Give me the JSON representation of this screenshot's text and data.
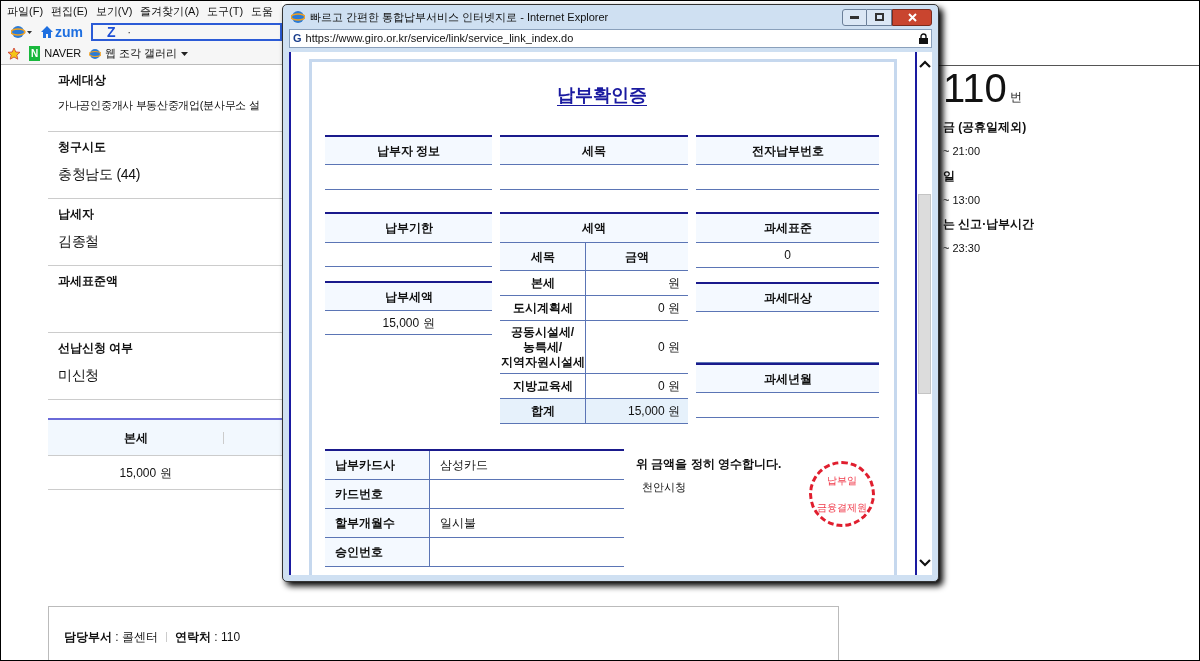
{
  "browser": {
    "menu": [
      "파일(F)",
      "편집(E)",
      "보기(V)",
      "즐겨찾기(A)",
      "도구(T)",
      "도움"
    ],
    "home_label": "zum",
    "search_logo": "Z",
    "address_text": "·",
    "favorites": [
      {
        "label": "NAVER",
        "badge": "N",
        "dropdown": false
      },
      {
        "label": "웹 조각 갤러리",
        "dropdown": true
      }
    ]
  },
  "page": {
    "fields": [
      {
        "label": "과세대상",
        "value": "가나공인중개사 부동산중개업(분사무소 설"
      },
      {
        "label": "청구시도",
        "value": "충청남도 (44)"
      },
      {
        "label": "납세자",
        "value": "김종철"
      },
      {
        "label": "과세표준액"
      },
      {
        "label": "선납신청 여부",
        "value": "미신청"
      }
    ],
    "table": {
      "columns": [
        "본세"
      ],
      "values": [
        "15,000 원"
      ]
    },
    "footer": [
      "**담당부서** : 콜센터",
      "**연락처** : 110"
    ]
  },
  "side": {
    "number": "110",
    "unit": "번",
    "lines": [
      {
        "kind": "heading",
        "text": "금 (공휴일제외)"
      },
      {
        "kind": "time",
        "text": "~ 21:00"
      },
      {
        "kind": "heading",
        "text": "일"
      },
      {
        "kind": "time",
        "text": "~ 13:00"
      },
      {
        "kind": "heading",
        "text": "는 신고·납부시간"
      },
      {
        "kind": "time",
        "text": "~ 23:30"
      }
    ]
  },
  "popup": {
    "title": "빠르고 간편한 통합납부서비스 인터넷지로 - Internet Explorer",
    "site_icon": "G",
    "url": "https://www.giro.or.kr/service/link/service_link_index.do",
    "receipt": {
      "title": "납부확인증",
      "row1": [
        {
          "header": "납부자 정보"
        },
        {
          "header": "세목"
        },
        {
          "header": "전자납부번호"
        }
      ],
      "deadline": {
        "header": "납부기한"
      },
      "paid_amount": {
        "header": "납부세액",
        "value": "15,000 원"
      },
      "tax": {
        "header": "세액",
        "columns": [
          "세목",
          "금액"
        ],
        "rows": [
          {
            "item": "본세",
            "amount": "원",
            "total": false
          },
          {
            "item": "도시계획세",
            "amount": "0 원",
            "total": false
          },
          {
            "item": "공동시설세/\n농특세/\n지역자원시설세",
            "amount": "0 원",
            "total": false
          },
          {
            "item": "지방교육세",
            "amount": "0 원",
            "total": false
          },
          {
            "item": "합계",
            "amount": "15,000 원",
            "total": true
          }
        ]
      },
      "right": [
        {
          "header": "과세표준",
          "value": "0"
        },
        {
          "header": "과세대상"
        },
        {
          "header": "과세년월"
        }
      ],
      "card": [
        {
          "label": "납부카드사",
          "value": "삼성카드"
        },
        {
          "label": "카드번호"
        },
        {
          "label": "할부개월수",
          "value": "일시불"
        },
        {
          "label": "승인번호"
        }
      ],
      "statement": "위 금액을 정히 영수합니다.",
      "issuer": "천안시청",
      "stamp": [
        "납부일",
        "금융결제원"
      ]
    }
  }
}
